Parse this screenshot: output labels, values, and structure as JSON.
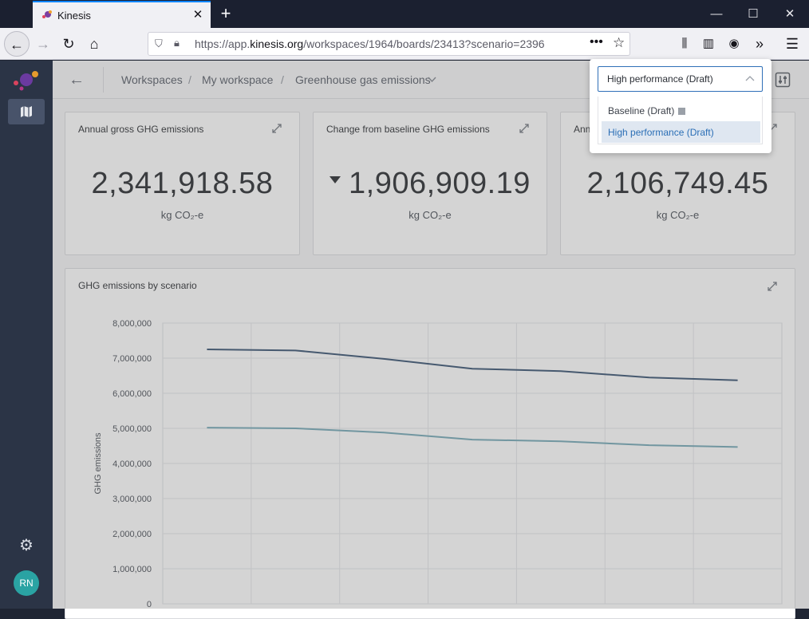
{
  "browser": {
    "tab_title": "Kinesis",
    "url_prefix": "https://app.",
    "url_domain": "kinesis.org",
    "url_path": "/workspaces/1964/boards/23413?scenario=2396"
  },
  "app": {
    "user_initials": "RN"
  },
  "breadcrumb": {
    "items": [
      "Workspaces",
      "My workspace",
      "Greenhouse gas emissions"
    ],
    "separator": "/"
  },
  "metrics": [
    {
      "title": "Annual gross GHG emissions",
      "value": "2,341,918.58",
      "unit": "kg CO₂-e"
    },
    {
      "title": "Change from baseline GHG emissions",
      "value": "1,906,909.19",
      "unit": "kg CO₂-e",
      "direction": "down"
    },
    {
      "title": "Annu",
      "value": "2,106,749.45",
      "unit": "kg CO₂-e"
    }
  ],
  "scenario_dropdown": {
    "selected": "High performance (Draft)",
    "options": [
      {
        "label": "Baseline (Draft)",
        "locked": true
      },
      {
        "label": "High performance (Draft)",
        "locked": false
      }
    ]
  },
  "chart_card": {
    "title": "GHG emissions by scenario"
  },
  "chart_data": {
    "type": "line",
    "title": "GHG emissions by scenario",
    "ylabel": "GHG emissions",
    "xlabel": "",
    "ylim": [
      0,
      8000000
    ],
    "yticks": [
      "0",
      "1,000,000",
      "2,000,000",
      "3,000,000",
      "4,000,000",
      "5,000,000",
      "6,000,000",
      "7,000,000",
      "8,000,000"
    ],
    "x": [
      1,
      2,
      3,
      4,
      5,
      6,
      7
    ],
    "series": [
      {
        "color": "#2f4a6b",
        "values": [
          7250000,
          7220000,
          6980000,
          6700000,
          6630000,
          6450000,
          6370000
        ]
      },
      {
        "color": "#6ea4b3",
        "values": [
          5020000,
          5000000,
          4880000,
          4680000,
          4630000,
          4520000,
          4470000
        ]
      }
    ],
    "grid": true
  }
}
